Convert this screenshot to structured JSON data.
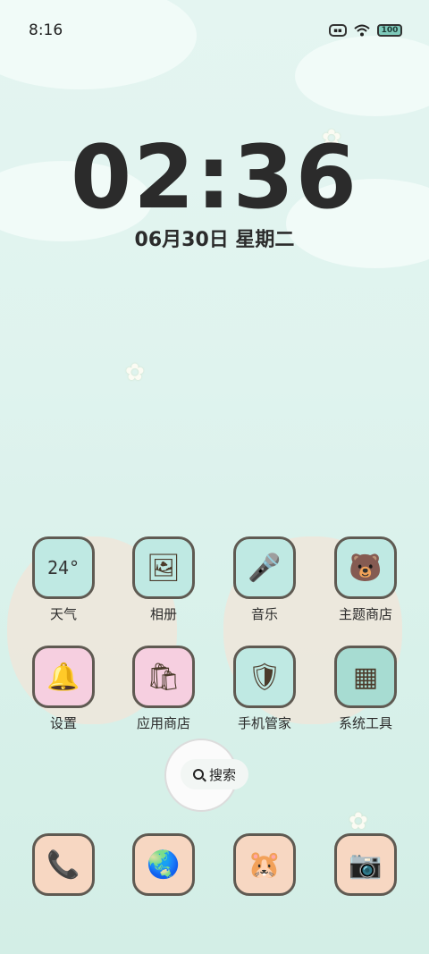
{
  "status_bar": {
    "time": "8:16",
    "battery_level": "100"
  },
  "clock": {
    "time": "02:36",
    "date": "06月30日 星期二"
  },
  "apps": [
    {
      "label": "天气",
      "icon": "weather-icon",
      "tile_text": "24°"
    },
    {
      "label": "相册",
      "icon": "album-icon"
    },
    {
      "label": "音乐",
      "icon": "music-icon"
    },
    {
      "label": "主题商店",
      "icon": "theme-store-icon"
    },
    {
      "label": "设置",
      "icon": "settings-icon"
    },
    {
      "label": "应用商店",
      "icon": "app-store-icon"
    },
    {
      "label": "手机管家",
      "icon": "phone-manager-icon"
    },
    {
      "label": "系统工具",
      "icon": "system-tools-icon"
    }
  ],
  "search": {
    "label": "搜索"
  },
  "dock": [
    {
      "icon": "phone-icon"
    },
    {
      "icon": "browser-icon"
    },
    {
      "icon": "gallery-icon"
    },
    {
      "icon": "camera-icon"
    }
  ],
  "colors": {
    "background": "#dff3ee",
    "tile_mint": "#bfe9e3",
    "tile_pink": "#f6cfe0",
    "tile_peach": "#f7d7c2"
  }
}
